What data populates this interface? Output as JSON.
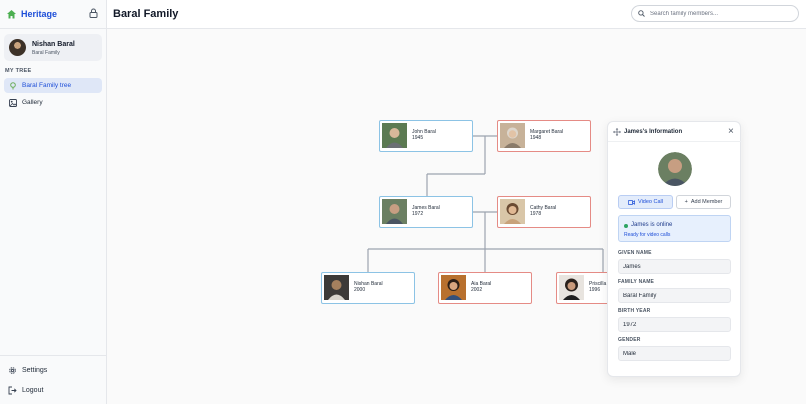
{
  "app": {
    "name": "Heritage"
  },
  "user": {
    "name": "Nishan Baral",
    "subtitle": "Baral Family"
  },
  "sidebar": {
    "section_label": "MY TREE",
    "items": [
      {
        "label": "Baral Family tree",
        "icon": "tree-icon",
        "active": true
      },
      {
        "label": "Gallery",
        "icon": "image-icon",
        "active": false
      }
    ],
    "bottom": [
      {
        "label": "Settings",
        "icon": "gear-icon"
      },
      {
        "label": "Logout",
        "icon": "logout-icon"
      }
    ]
  },
  "header": {
    "title": "Baral Family",
    "search_placeholder": "Search family members..."
  },
  "tree": {
    "nodes": [
      {
        "name": "John Baral",
        "year": "1945",
        "gender": "male"
      },
      {
        "name": "Margaret Baral",
        "year": "1948",
        "gender": "female"
      },
      {
        "name": "James Baral",
        "year": "1972",
        "gender": "male"
      },
      {
        "name": "Cathy Baral",
        "year": "1978",
        "gender": "female"
      },
      {
        "name": "Nishan Baral",
        "year": "2000",
        "gender": "male"
      },
      {
        "name": "Aia Baral",
        "year": "2002",
        "gender": "female"
      },
      {
        "name": "Priscilla",
        "year": "1996",
        "gender": "female"
      }
    ]
  },
  "panel": {
    "title": "James's Information",
    "video_call_label": "Video Call",
    "add_member_label": "Add Member",
    "online_text": "James is online",
    "online_sub": "Ready for video calls",
    "fields": [
      {
        "label": "GIVEN NAME",
        "value": "James"
      },
      {
        "label": "FAMILY NAME",
        "value": "Baral Family"
      },
      {
        "label": "BIRTH YEAR",
        "value": "1972"
      },
      {
        "label": "GENDER",
        "value": "Male"
      }
    ]
  },
  "colors": {
    "accent": "#1d4ed8",
    "male_border": "#8cc3e5",
    "female_border": "#e58b85",
    "online_dot": "#2ea463"
  }
}
